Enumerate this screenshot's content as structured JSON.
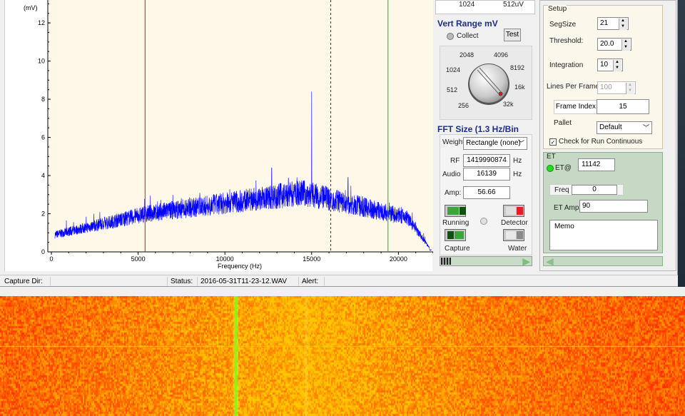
{
  "spectrum": {
    "y_unit": "(mV)",
    "y_ticks": [
      "12",
      "10",
      "8",
      "6",
      "4",
      "2",
      "0"
    ],
    "x_ticks": [
      "0",
      "5000",
      "10000",
      "15000",
      "20000"
    ],
    "xlabel": "Frequency (Hz)",
    "trace_color": "#0000ff",
    "marker_red_hz": 5400,
    "marker_dashed_hz": 16100,
    "marker_green_hz": 19400
  },
  "vert_range": {
    "top_values": [
      "1024",
      "512uV"
    ],
    "heading": "Vert Range mV",
    "collect_label": "Collect",
    "test_button": "Test",
    "dial_labels": [
      "2048",
      "4096",
      "1024",
      "8192",
      "512",
      "16k",
      "256",
      "32k"
    ]
  },
  "fft": {
    "heading": "FFT Size (1.3 Hz/Bin",
    "weight_label": "Weight",
    "weight_value": "Rectangle (none)",
    "rf_label": "RF",
    "rf_value": "1419990874",
    "rf_unit": "Hz",
    "audio_label": "Audio",
    "audio_value": "16139",
    "audio_unit": "Hz",
    "amp_label": "Amp:",
    "amp_value": "56.66",
    "running_label": "Running",
    "detector_label": "Detector",
    "capture_label": "Capture",
    "water_label": "Water"
  },
  "setup": {
    "title": "Setup",
    "segsize_label": "SegSize",
    "segsize_value": "21",
    "threshold_label": "Threshold:",
    "threshold_value": "20.0",
    "integration_label": "Integration",
    "integration_value": "10",
    "lines_label": "Lines Per Frame:",
    "lines_value": "100",
    "frame_index_label": "Frame Index",
    "frame_index_value": "15",
    "pallet_label": "Pallet",
    "pallet_value": "Default",
    "check_run_label": "Check for Run Continuous"
  },
  "et": {
    "title": "ET",
    "et_at_label": "ET@",
    "et_at_value": "11142",
    "freq_label": "Freq",
    "freq_value": "0",
    "amp_label": "ET Amp",
    "amp_value": "90",
    "memo_label": "Memo"
  },
  "status": {
    "capture_dir_label": "Capture Dir:",
    "capture_dir_value": "",
    "status_label": "Status:",
    "status_value": "2016-05-31T11-23-12.WAV",
    "alert_label": "Alert:",
    "alert_value": ""
  },
  "colors": {
    "waterfall_base": "#ff2a00",
    "waterfall_line": "#7fff00",
    "panel_title": "#1c2d8c"
  }
}
